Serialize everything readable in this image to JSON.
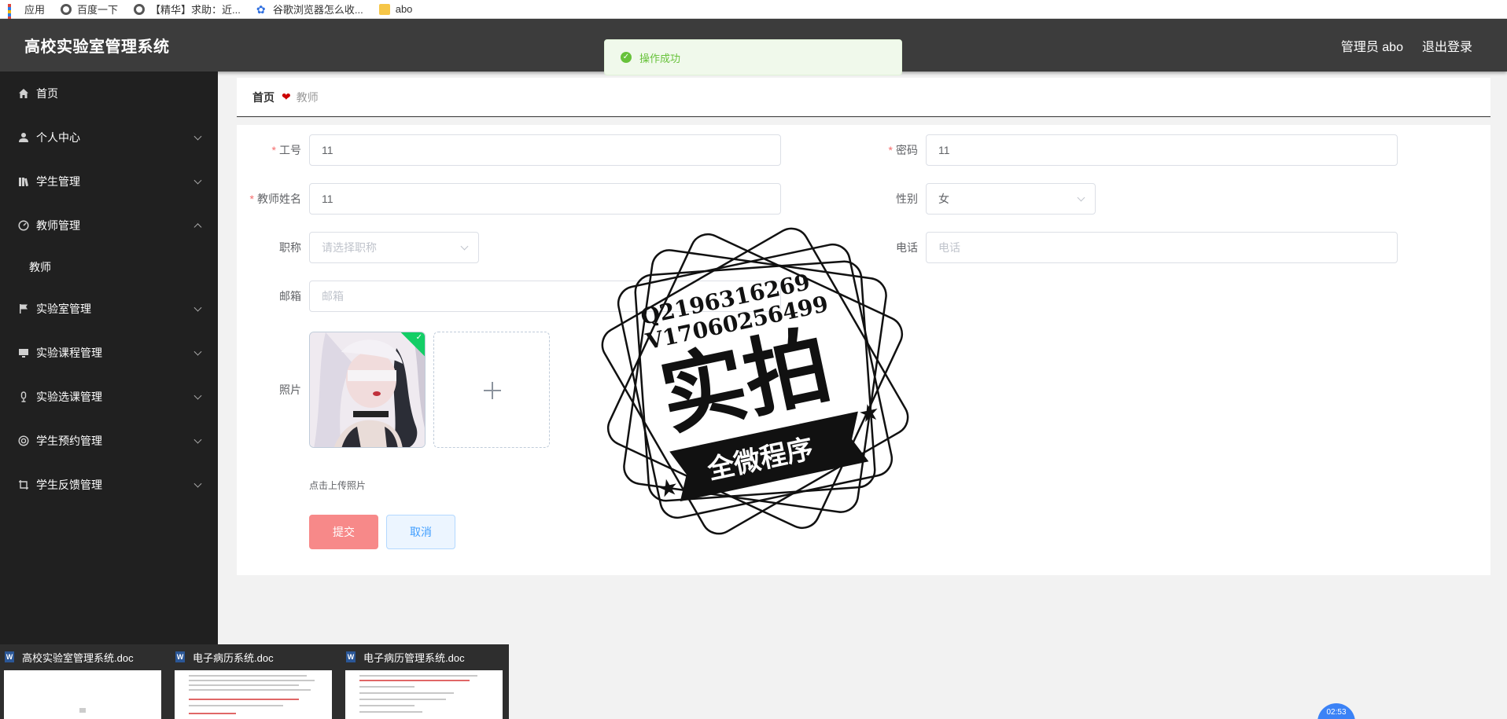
{
  "bookmarks": [
    {
      "label": "应用",
      "icon": "apps-grid-icon"
    },
    {
      "label": "百度一下",
      "icon": "globe-icon"
    },
    {
      "label": "【精华】求助：近...",
      "icon": "globe-icon"
    },
    {
      "label": "谷歌浏览器怎么收...",
      "icon": "paw-icon"
    },
    {
      "label": "abo",
      "icon": "folder-icon"
    }
  ],
  "header": {
    "title": "高校实验室管理系统",
    "user": "管理员 abo",
    "logout": "退出登录"
  },
  "toast": {
    "message": "操作成功",
    "color": "#67c23a"
  },
  "sidebar": {
    "items": [
      {
        "label": "首页",
        "icon": "home-icon"
      },
      {
        "label": "个人中心",
        "icon": "user-icon"
      },
      {
        "label": "学生管理",
        "icon": "books-icon"
      },
      {
        "label": "教师管理",
        "icon": "gauge-icon"
      },
      {
        "label": "教师",
        "icon": ""
      },
      {
        "label": "实验室管理",
        "icon": "flag-icon"
      },
      {
        "label": "实验课程管理",
        "icon": "monitor-icon"
      },
      {
        "label": "实验选课管理",
        "icon": "microphone-icon"
      },
      {
        "label": "学生预约管理",
        "icon": "circle-icon"
      },
      {
        "label": "学生反馈管理",
        "icon": "crop-icon"
      }
    ]
  },
  "breadcrumb": {
    "home": "首页",
    "current": "教师"
  },
  "form": {
    "gonghao": {
      "label": "工号",
      "value": "11"
    },
    "mima": {
      "label": "密码",
      "value": "11"
    },
    "jiaoshixingming": {
      "label": "教师姓名",
      "value": "11"
    },
    "xingbie": {
      "label": "性别",
      "value": "女"
    },
    "zhicheng": {
      "label": "职称",
      "placeholder": "请选择职称"
    },
    "dianhua": {
      "label": "电话",
      "placeholder": "电话"
    },
    "youxiang": {
      "label": "邮箱",
      "placeholder": "邮箱"
    },
    "zhaopian": {
      "label": "照片",
      "tip": "点击上传照片"
    },
    "submit": "提交",
    "cancel": "取消"
  },
  "watermark": {
    "line1": "Q2196316269",
    "line2": "V17060256499",
    "big": "实拍",
    "ribbon": "全微程序"
  },
  "taskbar": [
    {
      "label": "高校实验室管理系统.doc"
    },
    {
      "label": "电子病历系统.doc"
    },
    {
      "label": "电子病历管理系统.doc"
    }
  ],
  "clock": "02:53",
  "colors": {
    "header": "#3c3c3c",
    "sidebar": "#202020",
    "submit": "#f78989",
    "required": "#f56c6c"
  }
}
